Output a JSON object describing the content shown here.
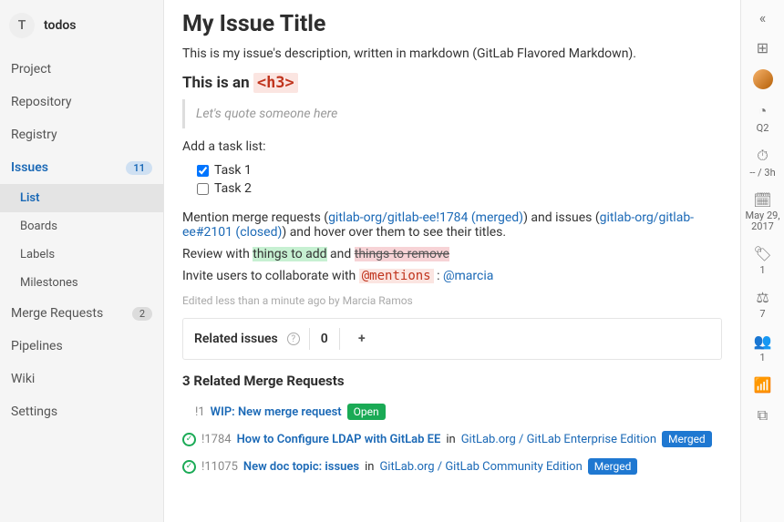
{
  "project": {
    "initial": "T",
    "name": "todos"
  },
  "sidebar": {
    "items": [
      {
        "label": "Project"
      },
      {
        "label": "Repository"
      },
      {
        "label": "Registry"
      },
      {
        "label": "Issues",
        "badge": "11",
        "active": true
      },
      {
        "label": "Merge Requests",
        "badge": "2"
      },
      {
        "label": "Pipelines"
      },
      {
        "label": "Wiki"
      },
      {
        "label": "Settings"
      }
    ],
    "issue_sub": [
      {
        "label": "List",
        "active": true
      },
      {
        "label": "Boards"
      },
      {
        "label": "Labels"
      },
      {
        "label": "Milestones"
      }
    ]
  },
  "issue": {
    "title": "My Issue Title",
    "description": "This is my issue's description, written in markdown (GitLab Flavored Markdown).",
    "h3_prefix": "This is an ",
    "h3_tag": "<h3>",
    "quote": "Let's quote someone here",
    "task_intro": "Add a task list:",
    "tasks": [
      {
        "label": "Task 1",
        "checked": true
      },
      {
        "label": "Task 2",
        "checked": false
      }
    ],
    "mention_pre": "Mention merge requests (",
    "mr_link": "gitlab-org/gitlab-ee!1784 (merged)",
    "mention_mid": ") and issues (",
    "issue_link": "gitlab-org/gitlab-ee#2101 (closed)",
    "mention_post": ") and hover over them to see their titles.",
    "review_pre": "Review with ",
    "review_add": "things to add",
    "review_and": " and ",
    "review_remove": "things to remove",
    "invite_pre": "Invite users to collaborate with ",
    "invite_code": "@mentions",
    "invite_mid": " : ",
    "invite_user": "@marcia",
    "edited": "Edited less than a minute ago by Marcia Ramos"
  },
  "related": {
    "label": "Related issues",
    "count": "0"
  },
  "mrs": {
    "heading": "3 Related Merge Requests",
    "list": [
      {
        "ref": "!1",
        "title": "WIP: New merge request",
        "status": "Open",
        "status_class": "open",
        "path": "",
        "in": ""
      },
      {
        "ref": "!1784",
        "title": "How to Configure LDAP with GitLab EE",
        "status": "Merged",
        "status_class": "merged",
        "in": " in ",
        "path": "GitLab.org / GitLab Enterprise Edition",
        "icon": true
      },
      {
        "ref": "!11075",
        "title": "New doc topic: issues",
        "status": "Merged",
        "status_class": "merged",
        "in": " in ",
        "path": "GitLab.org / GitLab Community Edition",
        "icon": true
      }
    ]
  },
  "rightbar": {
    "milestone": "Q2",
    "time": "-- / 3h",
    "date": "May 29, 2017",
    "labels": "1",
    "weight": "7",
    "participants": "1"
  }
}
